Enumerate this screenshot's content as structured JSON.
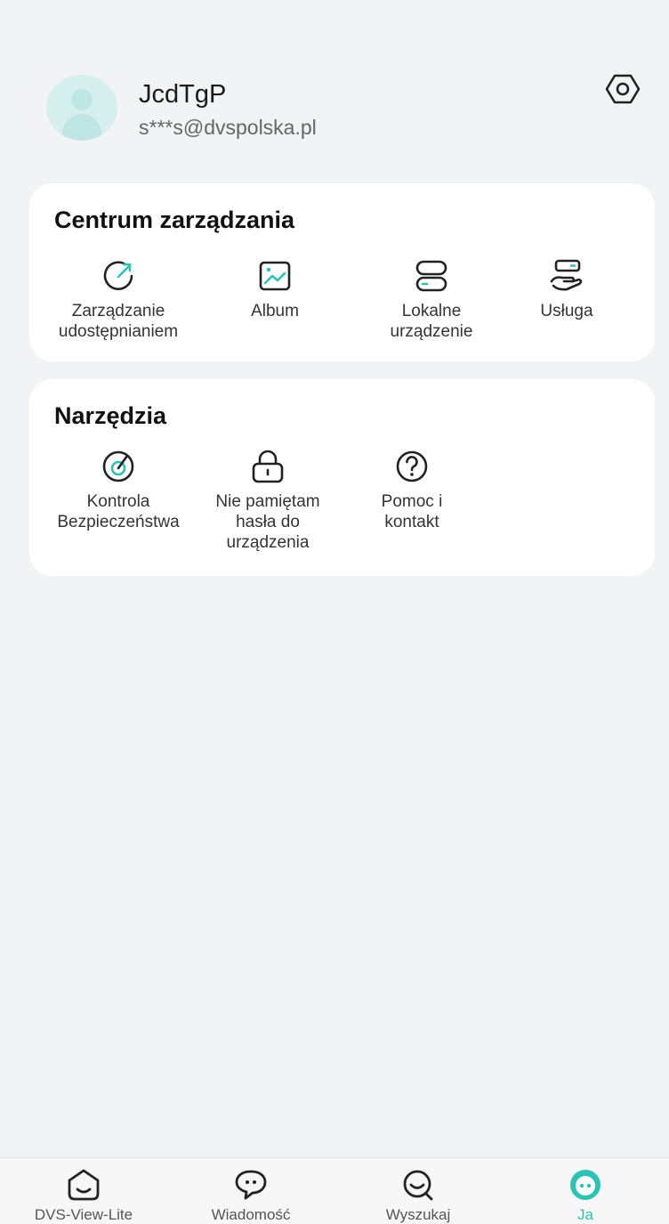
{
  "profile": {
    "username": "JcdTgP",
    "email": "s***s@dvspolska.pl"
  },
  "management": {
    "title": "Centrum zarządzania",
    "items": [
      {
        "label": "Zarządzanie\nudostępnianiem",
        "icon": "share-management-icon"
      },
      {
        "label": "Album",
        "icon": "album-icon"
      },
      {
        "label": "Lokalne\nurządzenie",
        "icon": "local-device-icon"
      },
      {
        "label": "Usługa",
        "icon": "service-icon"
      }
    ]
  },
  "tools": {
    "title": "Narzędzia",
    "items": [
      {
        "label": "Kontrola\nBezpieczeństwa",
        "icon": "security-check-icon"
      },
      {
        "label": "Nie pamiętam\nhasła do\nurządzenia",
        "icon": "lock-icon"
      },
      {
        "label": "Pomoc i\nkontakt",
        "icon": "help-icon"
      }
    ]
  },
  "nav": {
    "items": [
      {
        "label": "DVS-View-Lite",
        "icon": "home-icon"
      },
      {
        "label": "Wiadomość",
        "icon": "message-icon"
      },
      {
        "label": "Wyszukaj",
        "icon": "search-icon"
      },
      {
        "label": "Ja",
        "icon": "me-icon",
        "active": true
      }
    ]
  },
  "colors": {
    "accent": "#2cc3b2",
    "background": "#f2f3f5",
    "card": "#ffffff"
  }
}
